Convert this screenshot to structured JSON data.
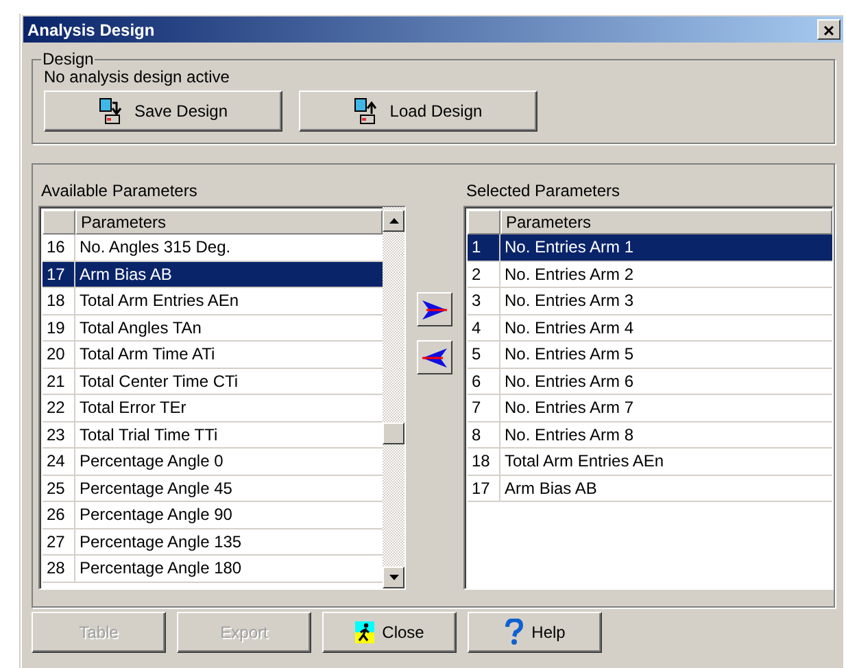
{
  "window": {
    "title": "Analysis Design",
    "close": "×"
  },
  "design": {
    "legend": "Design",
    "status": "No analysis design active",
    "buttons": [
      {
        "kind": "save",
        "label": "Save Design"
      },
      {
        "kind": "load",
        "label": "Load Design"
      }
    ]
  },
  "available": {
    "label": "Available Parameters",
    "header": "Parameters",
    "rows": [
      {
        "num": "16",
        "name": "No. Angles 315 Deg.",
        "selected": false
      },
      {
        "num": "17",
        "name": "Arm Bias AB",
        "selected": true
      },
      {
        "num": "18",
        "name": "Total Arm Entries AEn",
        "selected": false
      },
      {
        "num": "19",
        "name": "Total Angles TAn",
        "selected": false
      },
      {
        "num": "20",
        "name": "Total Arm Time ATi",
        "selected": false
      },
      {
        "num": "21",
        "name": "Total Center Time CTi",
        "selected": false
      },
      {
        "num": "22",
        "name": "Total Error TEr",
        "selected": false
      },
      {
        "num": "23",
        "name": "Total Trial Time TTi",
        "selected": false
      },
      {
        "num": "24",
        "name": "Percentage Angle 0",
        "selected": false
      },
      {
        "num": "25",
        "name": "Percentage Angle 45",
        "selected": false
      },
      {
        "num": "26",
        "name": "Percentage Angle 90",
        "selected": false
      },
      {
        "num": "27",
        "name": "Percentage Angle 135",
        "selected": false
      },
      {
        "num": "28",
        "name": "Percentage Angle 180",
        "selected": false
      }
    ]
  },
  "selected": {
    "label": "Selected Parameters",
    "header": "Parameters",
    "rows": [
      {
        "num": "1",
        "name": "No. Entries Arm 1",
        "selected": true
      },
      {
        "num": "2",
        "name": "No. Entries Arm 2",
        "selected": false
      },
      {
        "num": "3",
        "name": "No. Entries Arm 3",
        "selected": false
      },
      {
        "num": "4",
        "name": "No. Entries Arm 4",
        "selected": false
      },
      {
        "num": "5",
        "name": "No. Entries Arm 5",
        "selected": false
      },
      {
        "num": "6",
        "name": "No. Entries Arm 6",
        "selected": false
      },
      {
        "num": "7",
        "name": "No. Entries Arm 7",
        "selected": false
      },
      {
        "num": "8",
        "name": "No. Entries Arm 8",
        "selected": false
      },
      {
        "num": "18",
        "name": "Total Arm Entries AEn",
        "selected": false
      },
      {
        "num": "17",
        "name": "Arm Bias AB",
        "selected": false
      }
    ]
  },
  "footer": [
    {
      "kind": "table",
      "label": "Table",
      "disabled": true
    },
    {
      "kind": "export",
      "label": "Export",
      "disabled": true
    },
    {
      "kind": "close",
      "label": "Close",
      "disabled": false
    },
    {
      "kind": "help",
      "label": "Help",
      "disabled": false
    }
  ]
}
